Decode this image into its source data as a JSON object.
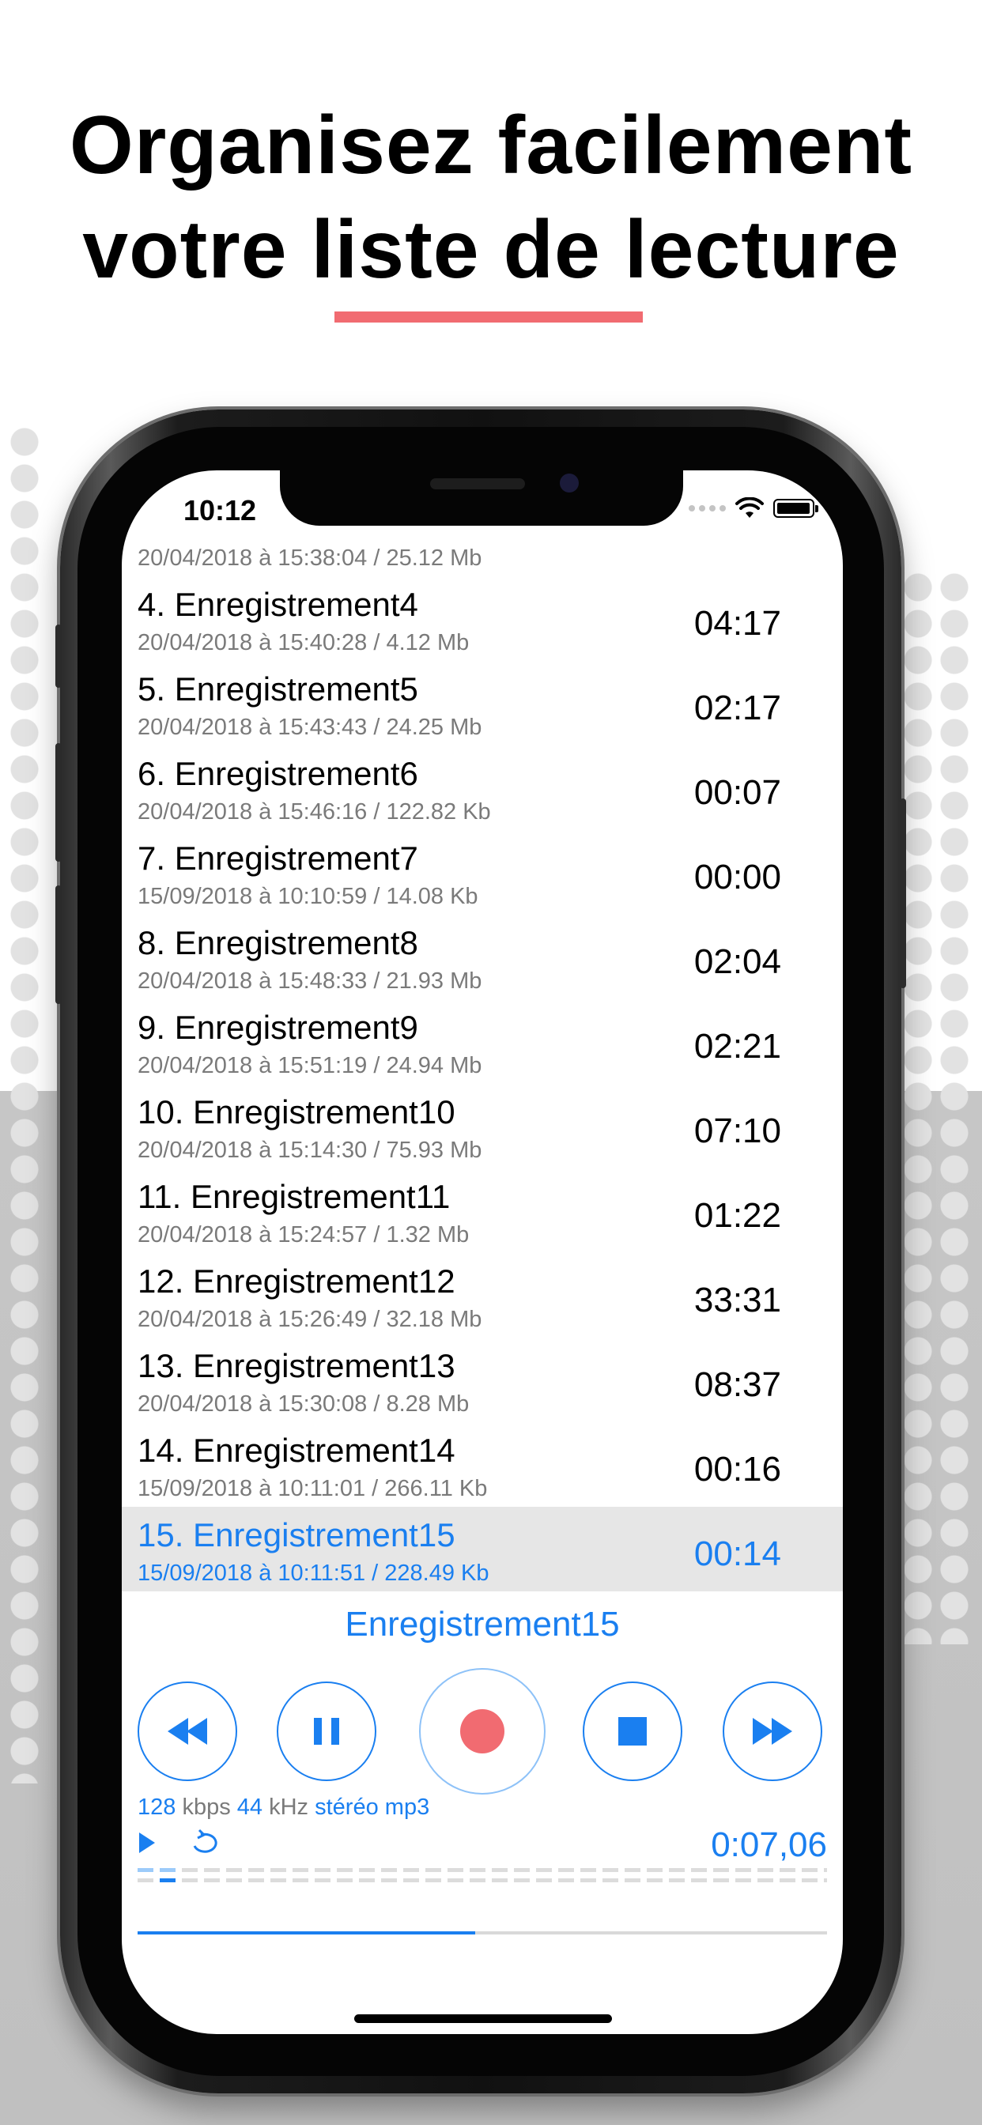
{
  "headline": {
    "line1": "Organisez facilement",
    "line2": "votre liste de lecture",
    "underline_color": "#f16b71"
  },
  "status_bar": {
    "time": "10:12",
    "icons": [
      "cellular-signal-icon",
      "wifi-icon",
      "battery-icon"
    ]
  },
  "recordings": {
    "partial_top_sub": "20/04/2018 à 15:38:04 / 25.12 Mb",
    "items": [
      {
        "title": "4. Enregistrement4",
        "sub": "20/04/2018 à 15:40:28 / 4.12 Mb",
        "duration": "04:17"
      },
      {
        "title": "5. Enregistrement5",
        "sub": "20/04/2018 à 15:43:43 / 24.25 Mb",
        "duration": "02:17"
      },
      {
        "title": "6. Enregistrement6",
        "sub": "20/04/2018 à 15:46:16 / 122.82 Kb",
        "duration": "00:07"
      },
      {
        "title": "7. Enregistrement7",
        "sub": "15/09/2018 à 10:10:59 / 14.08 Kb",
        "duration": "00:00"
      },
      {
        "title": "8. Enregistrement8",
        "sub": "20/04/2018 à 15:48:33 / 21.93 Mb",
        "duration": "02:04"
      },
      {
        "title": "9. Enregistrement9",
        "sub": "20/04/2018 à 15:51:19 / 24.94 Mb",
        "duration": "02:21"
      },
      {
        "title": "10. Enregistrement10",
        "sub": "20/04/2018 à 15:14:30 / 75.93 Mb",
        "duration": "07:10"
      },
      {
        "title": "11. Enregistrement11",
        "sub": "20/04/2018 à 15:24:57 / 1.32 Mb",
        "duration": "01:22"
      },
      {
        "title": "12. Enregistrement12",
        "sub": "20/04/2018 à 15:26:49 / 32.18 Mb",
        "duration": "33:31"
      },
      {
        "title": "13. Enregistrement13",
        "sub": "20/04/2018 à 15:30:08 / 8.28 Mb",
        "duration": "08:37"
      },
      {
        "title": "14. Enregistrement14",
        "sub": "15/09/2018 à 10:11:01 / 266.11 Kb",
        "duration": "00:16"
      },
      {
        "title": "15. Enregistrement15",
        "sub": "15/09/2018 à 10:11:51 / 228.49 Kb",
        "duration": "00:14",
        "selected": true
      }
    ]
  },
  "player": {
    "now_playing": "Enregistrement15",
    "controls": [
      "rewind-icon",
      "pause-icon",
      "record-icon",
      "stop-icon",
      "fast-forward-icon"
    ],
    "format": {
      "bitrate": "128",
      "bitrate_unit": "kbps",
      "sample_rate": "44",
      "sample_rate_unit": "kHz",
      "channels": "stéréo",
      "codec": "mp3"
    },
    "elapsed": "0:07,06",
    "progress_fraction": 0.49,
    "colors": {
      "accent": "#1a7ff0",
      "record": "#f16b71",
      "selected_row": "#e6e6e6"
    }
  }
}
